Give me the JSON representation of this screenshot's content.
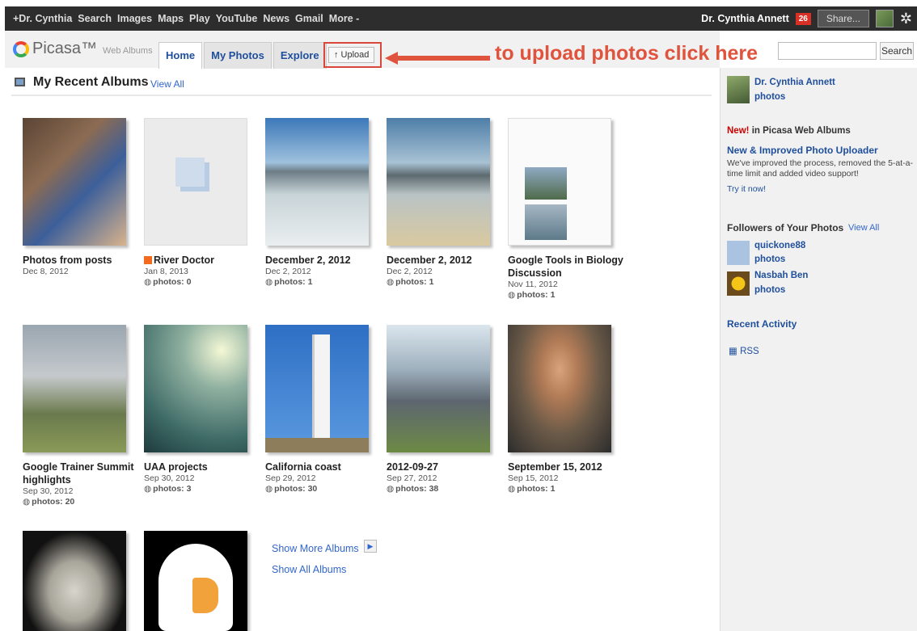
{
  "gbar": {
    "links": [
      "+Dr. Cynthia",
      "Search",
      "Images",
      "Maps",
      "Play",
      "YouTube",
      "News",
      "Gmail",
      "More -"
    ],
    "user": "Dr. Cynthia Annett",
    "notifications": "26",
    "share": "Share..."
  },
  "header": {
    "logo": "Picasa™",
    "logo_sub": "Web Albums",
    "tabs": [
      "Home",
      "My Photos",
      "Explore"
    ],
    "upload": "↑ Upload",
    "annotation": "to upload photos click here",
    "search_button": "Search",
    "search_value": ""
  },
  "section": {
    "title": "My Recent Albums",
    "view_all": "View All"
  },
  "albums": [
    {
      "title": "Photos from posts",
      "date": "Dec 8, 2012",
      "photos": ""
    },
    {
      "title": "River Doctor",
      "date": "Jan 8, 2013",
      "photos": "photos: 0"
    },
    {
      "title": "December 2, 2012",
      "date": "Dec 2, 2012",
      "photos": "photos: 1"
    },
    {
      "title": "December 2, 2012",
      "date": "Dec 2, 2012",
      "photos": "photos: 1"
    },
    {
      "title": "Google Tools in Biology Discussion",
      "date": "Nov 11, 2012",
      "photos": "photos: 1"
    },
    {
      "title": "Google Trainer Summit highlights",
      "date": "Sep 30, 2012",
      "photos": "photos: 20"
    },
    {
      "title": "UAA projects",
      "date": "Sep 30, 2012",
      "photos": "photos: 3"
    },
    {
      "title": "California coast",
      "date": "Sep 29, 2012",
      "photos": "photos: 30"
    },
    {
      "title": "2012-09-27",
      "date": "Sep 27, 2012",
      "photos": "photos: 38"
    },
    {
      "title": "September 15, 2012",
      "date": "Sep 15, 2012",
      "photos": "photos: 1"
    }
  ],
  "more": {
    "show_more": "Show More Albums",
    "show_all": "Show All Albums"
  },
  "sidebar": {
    "user_name": "Dr. Cynthia Annett",
    "user_photos": "photos",
    "new_label": "New!",
    "new_suffix": "in Picasa Web Albums",
    "uploader_title": "New & Improved Photo Uploader",
    "uploader_desc": "We've improved the process, removed the 5-at-a-time limit and added video support!",
    "try_now": "Try it now!",
    "followers_title": "Followers of Your Photos",
    "followers_view_all": "View All",
    "followers": [
      {
        "name": "quickone88",
        "photos": "photos"
      },
      {
        "name": "Nasbah Ben",
        "photos": "photos"
      }
    ],
    "recent_activity": "Recent Activity",
    "rss": "RSS"
  },
  "colors": {
    "annotation": "#e0533d",
    "link": "#1f4f9c",
    "accent_red": "#d93025"
  }
}
